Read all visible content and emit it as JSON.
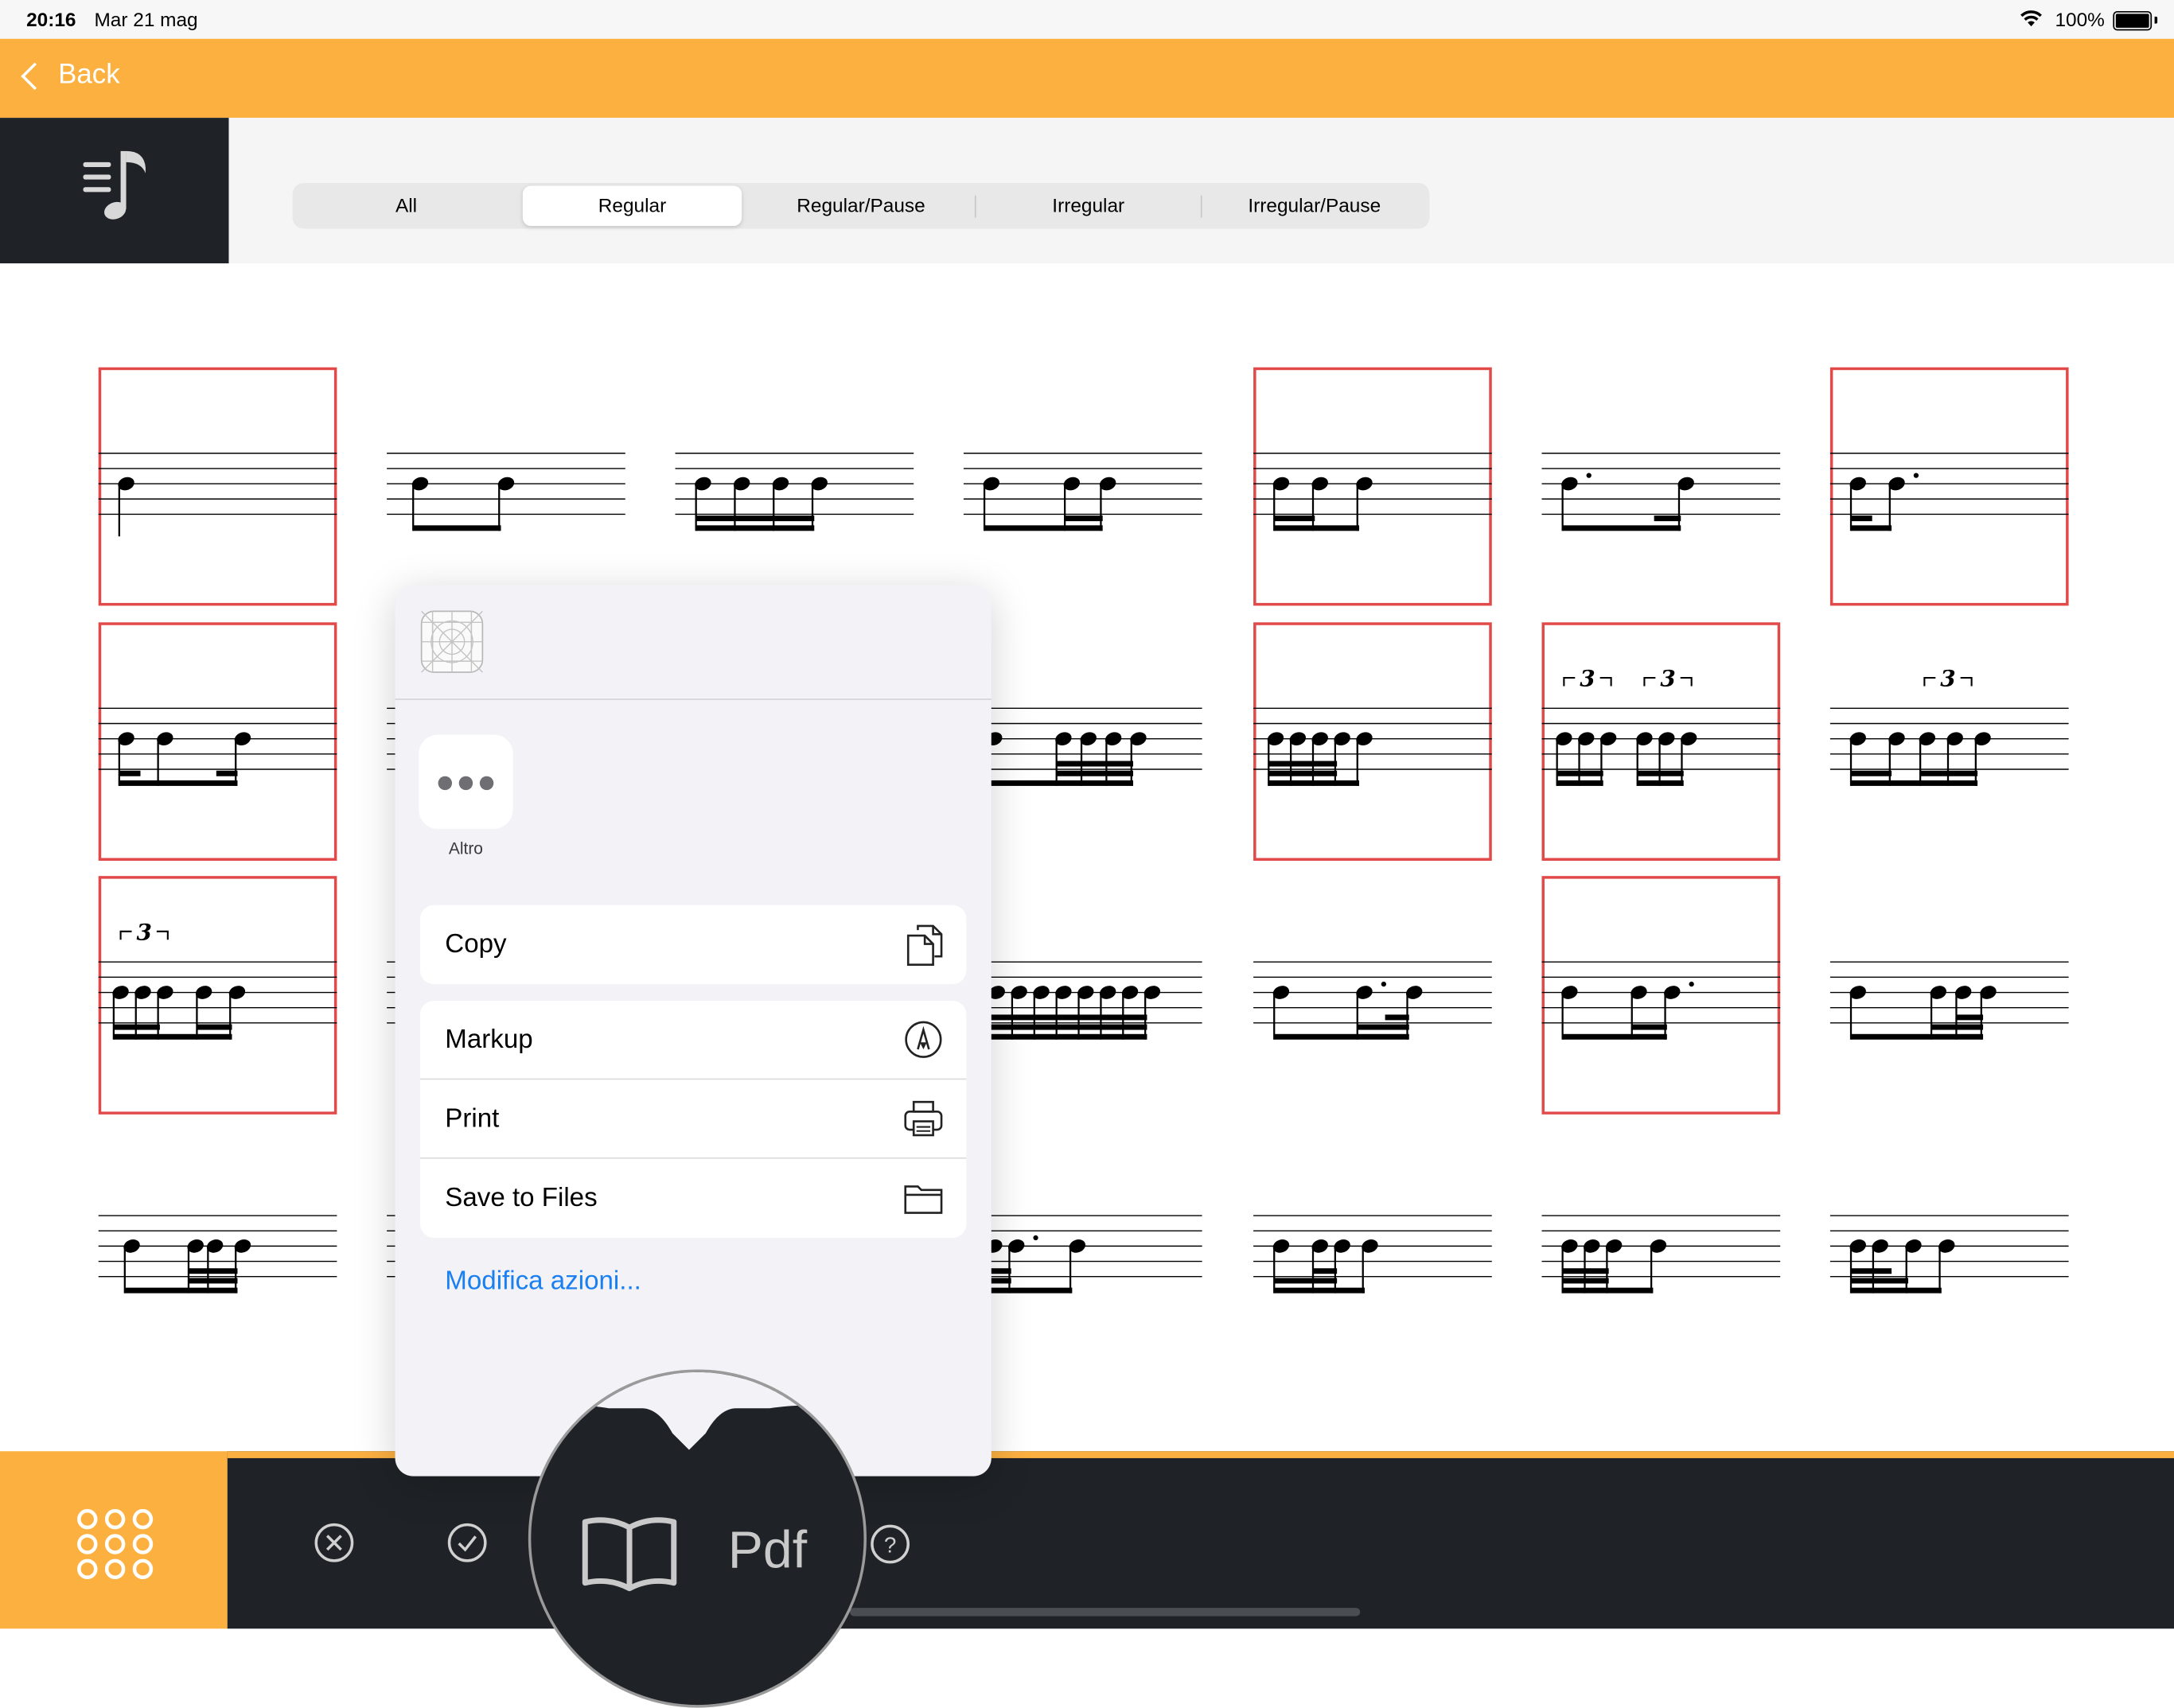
{
  "status_bar": {
    "time": "20:16",
    "date": "Mar 21 mag",
    "battery": "100%"
  },
  "nav": {
    "back_label": "Back"
  },
  "tabs": [
    {
      "label": "All",
      "active": false
    },
    {
      "label": "Regular",
      "active": true
    },
    {
      "label": "Regular/Pause",
      "active": false
    },
    {
      "label": "Irregular",
      "active": false
    },
    {
      "label": "Irregular/Pause",
      "active": false
    }
  ],
  "share_sheet": {
    "more_label": "Altro",
    "actions_primary": [
      {
        "label": "Copy",
        "icon": "copy-icon"
      }
    ],
    "actions_secondary": [
      {
        "label": "Markup",
        "icon": "markup-icon"
      },
      {
        "label": "Print",
        "icon": "print-icon"
      },
      {
        "label": "Save to Files",
        "icon": "folder-icon"
      }
    ],
    "edit_actions_label": "Modifica azioni..."
  },
  "toolbar": {
    "pdf_label": "Pdf",
    "icons": [
      "grid-dots-icon",
      "close-circle-icon",
      "check-circle-icon",
      "book-icon",
      "help-icon"
    ]
  },
  "rhythm_grid": {
    "columns": 7,
    "rows": 4,
    "selected_cells": [
      [
        0,
        0
      ],
      [
        0,
        4
      ],
      [
        0,
        6
      ],
      [
        1,
        0
      ],
      [
        1,
        4
      ],
      [
        1,
        5
      ],
      [
        2,
        0
      ],
      [
        2,
        5
      ]
    ],
    "triplet_marks": {
      "1-5": [
        "3",
        "3"
      ],
      "1-6": [
        "3"
      ],
      "2-0": [
        "3"
      ]
    },
    "colors": {
      "accent": "#fbb040",
      "dark": "#1f2327",
      "selection": "#e24a4a",
      "link": "#1a7ff0"
    }
  }
}
